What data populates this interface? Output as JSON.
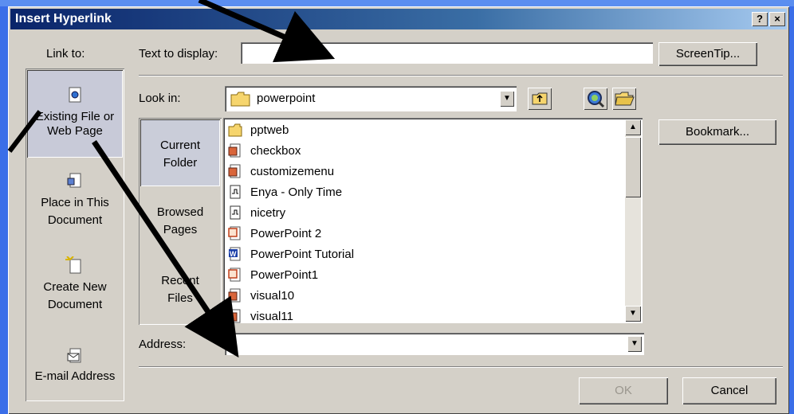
{
  "window": {
    "title": "Insert Hyperlink",
    "help_label": "?",
    "close_label": "×"
  },
  "link_to": {
    "heading": "Link to:",
    "items": [
      {
        "label_line1": "Existing File or",
        "label_line2": "Web Page",
        "icon": "web-page-icon",
        "selected": true
      },
      {
        "label_line1": "Place in This",
        "label_line2": "Document",
        "icon": "document-place-icon",
        "selected": false
      },
      {
        "label_line1": "Create New",
        "label_line2": "Document",
        "icon": "new-document-icon",
        "selected": false
      },
      {
        "label_line1": "E-mail Address",
        "label_line2": "",
        "icon": "email-icon",
        "selected": false
      }
    ]
  },
  "text_to_display": {
    "label": "Text to display:",
    "value": ""
  },
  "screentip_label": "ScreenTip...",
  "look_in": {
    "label": "Look in:",
    "value": "powerpoint"
  },
  "side_nav": {
    "items": [
      {
        "line1": "Current",
        "line2": "Folder",
        "selected": true
      },
      {
        "line1": "Browsed",
        "line2": "Pages",
        "selected": false
      },
      {
        "line1": "Recent",
        "line2": "Files",
        "selected": false
      }
    ]
  },
  "files": [
    {
      "name": "pptweb",
      "type": "folder"
    },
    {
      "name": "checkbox",
      "type": "html"
    },
    {
      "name": "customizemenu",
      "type": "html"
    },
    {
      "name": "Enya - Only Time",
      "type": "audio"
    },
    {
      "name": "nicetry",
      "type": "audio"
    },
    {
      "name": "PowerPoint 2",
      "type": "ppt"
    },
    {
      "name": "PowerPoint Tutorial",
      "type": "word"
    },
    {
      "name": "PowerPoint1",
      "type": "ppt"
    },
    {
      "name": "visual10",
      "type": "html"
    },
    {
      "name": "visual11",
      "type": "html"
    }
  ],
  "bookmark_label": "Bookmark...",
  "address": {
    "label": "Address:",
    "value": ""
  },
  "ok_label": "OK",
  "cancel_label": "Cancel",
  "colors": {
    "desktop": "#3a6ee8",
    "dialog": "#d4d0c8",
    "titlebar": "#0a246a"
  }
}
